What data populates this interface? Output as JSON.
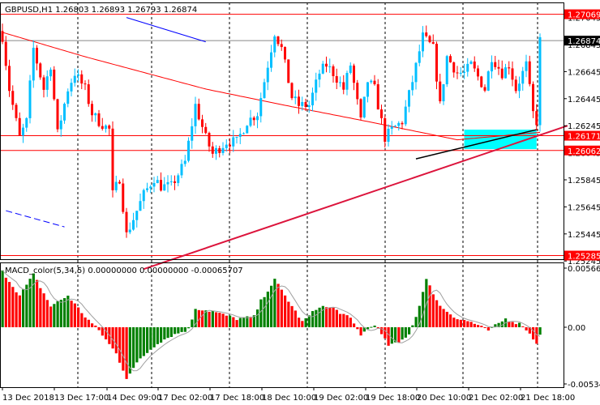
{
  "chart_data": {
    "type": "candlestick",
    "symbol_header": "GBPUSD,H1  1.26803 1.26893 1.26793 1.26874",
    "price_axis": {
      "range": [
        1.25185,
        1.2714
      ],
      "ticks": [
        "1.27045",
        "1.26845",
        "1.26645",
        "1.26445",
        "1.26245",
        "1.26045",
        "1.25845",
        "1.25645",
        "1.25445",
        "1.25245"
      ],
      "tick_values": [
        1.27045,
        1.26845,
        1.26645,
        1.26445,
        1.26245,
        1.26045,
        1.25845,
        1.25645,
        1.25445,
        1.25245
      ]
    },
    "price_labels": [
      {
        "text": "1.27069",
        "value": 1.27069,
        "color": "#ff0000"
      },
      {
        "text": "1.26874",
        "value": 1.26874,
        "color": "#000000"
      },
      {
        "text": "1.26171",
        "value": 1.26171,
        "color": "#ff0000"
      },
      {
        "text": "1.26062",
        "value": 1.26062,
        "color": "#ff0000"
      },
      {
        "text": "1.25285",
        "value": 1.25285,
        "color": "#ff0000"
      }
    ],
    "time_labels": [
      "13 Dec 2018",
      "13 Dec 17:00",
      "14 Dec 09:00",
      "17 Dec 02:00",
      "17 Dec 18:00",
      "18 Dec 10:00",
      "19 Dec 02:00",
      "19 Dec 18:00",
      "20 Dec 10:00",
      "21 Dec 02:00",
      "21 Dec 18:00"
    ],
    "bars_total": 157,
    "close_keypoints_bar_price": [
      [
        0,
        1.26905
      ],
      [
        2,
        1.26516
      ],
      [
        5,
        1.26156
      ],
      [
        7,
        1.26276
      ],
      [
        9,
        1.26815
      ],
      [
        12,
        1.26516
      ],
      [
        14,
        1.26695
      ],
      [
        16,
        1.26186
      ],
      [
        19,
        1.26516
      ],
      [
        21,
        1.26635
      ],
      [
        24,
        1.26516
      ],
      [
        26,
        1.26336
      ],
      [
        28,
        1.26276
      ],
      [
        31,
        1.26216
      ],
      [
        32,
        1.25737
      ],
      [
        34,
        1.25857
      ],
      [
        36,
        1.25438
      ],
      [
        39,
        1.25617
      ],
      [
        41,
        1.25737
      ],
      [
        44,
        1.25857
      ],
      [
        46,
        1.25797
      ],
      [
        49,
        1.25797
      ],
      [
        53,
        1.25976
      ],
      [
        56,
        1.26396
      ],
      [
        59,
        1.26156
      ],
      [
        61,
        1.26036
      ],
      [
        65,
        1.26126
      ],
      [
        68,
        1.26126
      ],
      [
        71,
        1.26276
      ],
      [
        74,
        1.26336
      ],
      [
        76,
        1.26575
      ],
      [
        79,
        1.26935
      ],
      [
        81,
        1.26815
      ],
      [
        84,
        1.26456
      ],
      [
        86,
        1.26396
      ],
      [
        89,
        1.26396
      ],
      [
        92,
        1.26635
      ],
      [
        94,
        1.26695
      ],
      [
        96,
        1.26635
      ],
      [
        99,
        1.26516
      ],
      [
        101,
        1.26695
      ],
      [
        104,
        1.26276
      ],
      [
        106,
        1.26575
      ],
      [
        108,
        1.26516
      ],
      [
        111,
        1.26156
      ],
      [
        113,
        1.26216
      ],
      [
        116,
        1.26276
      ],
      [
        119,
        1.26575
      ],
      [
        122,
        1.26905
      ],
      [
        125,
        1.26815
      ],
      [
        127,
        1.26396
      ],
      [
        129,
        1.26755
      ],
      [
        132,
        1.26635
      ],
      [
        134,
        1.26635
      ],
      [
        136,
        1.26695
      ],
      [
        140,
        1.26516
      ],
      [
        142,
        1.26755
      ],
      [
        145,
        1.26635
      ],
      [
        147,
        1.26695
      ],
      [
        149,
        1.26516
      ],
      [
        152,
        1.26695
      ],
      [
        154,
        1.26336
      ],
      [
        155,
        1.26276
      ],
      [
        156,
        1.26874
      ]
    ],
    "moving_average_keypoints_bar_price": [
      [
        0,
        1.26935
      ],
      [
        24,
        1.26755
      ],
      [
        59,
        1.26516
      ],
      [
        82,
        1.26396
      ],
      [
        106,
        1.26276
      ],
      [
        132,
        1.26141
      ],
      [
        156,
        1.26196
      ]
    ],
    "trendline": {
      "from_bar_price": [
        41,
        1.25185
      ],
      "to_bar_price": [
        164,
        1.26245
      ],
      "color": "#dc143c"
    },
    "blue_lines": [
      {
        "from": [
          36,
          1.27045
        ],
        "to": [
          59,
          1.26865
        ],
        "style": "solid"
      },
      {
        "from": [
          1,
          1.25617
        ],
        "to": [
          18,
          1.25497
        ],
        "style": "dashed"
      }
    ],
    "zone_rectangle": {
      "from_bar": 134,
      "to_bar": 155,
      "price_top": 1.26216,
      "price_bottom": 1.26072,
      "color": "#00ffff"
    },
    "colors": {
      "bull": "#00bfff",
      "bear": "#ff0000",
      "ma": "#ff0000",
      "hline": "#ff0000",
      "trend": "#dc143c"
    },
    "macd": {
      "label": "MACD_color(5,34,5) 0.00000000 0.00000000 -0.00065707",
      "axis_labels": [
        "0.0056653",
        "0.00",
        "-0.005343"
      ],
      "axis_values": [
        0.0056653,
        0,
        -0.005343
      ],
      "keypoints_bar_value": [
        [
          0,
          0.0053
        ],
        [
          5,
          0.003
        ],
        [
          9,
          0.005
        ],
        [
          14,
          0.002
        ],
        [
          19,
          0.003
        ],
        [
          24,
          0.001
        ],
        [
          28,
          -0.0003
        ],
        [
          33,
          -0.0025
        ],
        [
          36,
          -0.0048
        ],
        [
          40,
          -0.003
        ],
        [
          45,
          -0.0015
        ],
        [
          49,
          -0.0008
        ],
        [
          54,
          -0.0002
        ],
        [
          56,
          0.0018
        ],
        [
          61,
          0.0015
        ],
        [
          68,
          0.0008
        ],
        [
          73,
          0.001
        ],
        [
          75,
          0.0025
        ],
        [
          79,
          0.0045
        ],
        [
          82,
          0.003
        ],
        [
          87,
          0.0005
        ],
        [
          92,
          0.002
        ],
        [
          96,
          0.0018
        ],
        [
          101,
          0.0008
        ],
        [
          104,
          -0.0007
        ],
        [
          108,
          0.0003
        ],
        [
          112,
          -0.0017
        ],
        [
          115,
          -0.0015
        ],
        [
          118,
          -0.0006
        ],
        [
          120,
          0.001
        ],
        [
          123,
          0.0045
        ],
        [
          127,
          0.002
        ],
        [
          132,
          0.0008
        ],
        [
          136,
          0.0005
        ],
        [
          141,
          -0.0003
        ],
        [
          146,
          0.0008
        ],
        [
          151,
          0.0002
        ],
        [
          155,
          -0.0015
        ],
        [
          156,
          -0.0006
        ]
      ],
      "colors": {
        "up": "#008000",
        "down": "#ff0000",
        "signal": "#a0a0a0"
      }
    }
  }
}
